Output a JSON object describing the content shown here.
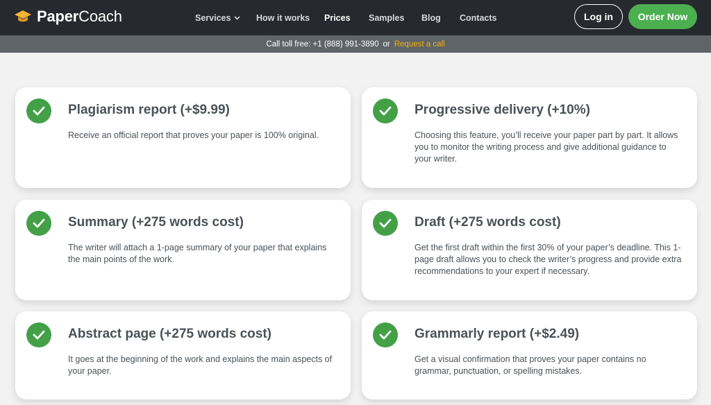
{
  "header": {
    "logo": {
      "bold": "Paper",
      "regular": "Coach",
      "icon": "graduation-cap-icon"
    },
    "nav": [
      {
        "label": "Services",
        "icon": "chevron-down-icon"
      },
      {
        "label": "How it works"
      },
      {
        "label": "Prices"
      },
      {
        "label": "Samples"
      },
      {
        "label": "Blog"
      },
      {
        "label": "Contacts"
      }
    ],
    "login_label": "Log in",
    "order_label": "Order Now"
  },
  "tollbar": {
    "text": "Call toll free: +1 (888) 991-3890",
    "or": "or",
    "request_link": "Request a call"
  },
  "features": [
    {
      "title": "Plagiarism report (+$9.99)",
      "description": "Receive an official report that proves your paper is 100% original."
    },
    {
      "title": "Progressive delivery (+10%)",
      "description": "Choosing this feature, you’ll receive your paper part by part. It allows you to monitor the writing process and give additional guidance to your writer."
    },
    {
      "title": "Summary (+275 words cost)",
      "description": "The writer will attach a 1-page summary of your paper that explains the main points of the work."
    },
    {
      "title": "Draft (+275 words cost)",
      "description": "Get the first draft within the first 30% of your paper’s deadline. This 1-page draft allows you to check the writer’s progress and provide extra recommendations to your expert if necessary."
    },
    {
      "title": "Abstract page (+275 words cost)",
      "description": "It goes at the beginning of the work and explains the main aspects of your paper."
    },
    {
      "title": "Grammarly report (+$2.49)",
      "description": "Get a visual confirmation that proves your paper contains no grammar, punctuation, or spelling mistakes."
    }
  ],
  "colors": {
    "navbar": "#26292d",
    "tollbar": "#5f6469",
    "accent_green": "#4caf50",
    "check_green": "#43a047",
    "request_link": "#f4b400",
    "text": "#4b5157"
  }
}
